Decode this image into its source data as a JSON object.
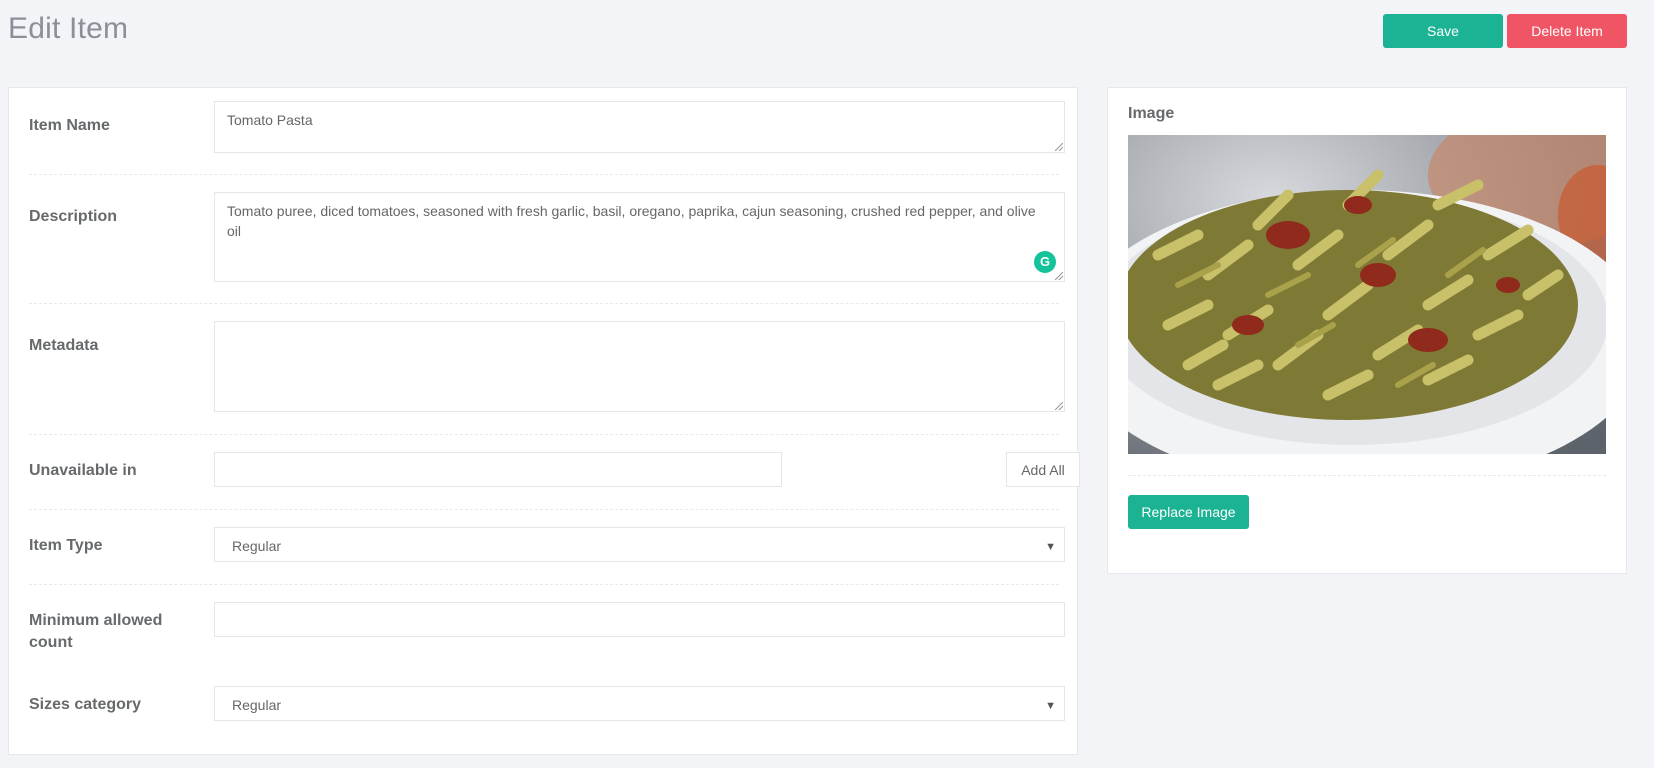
{
  "header": {
    "title": "Edit Item",
    "save_label": "Save",
    "delete_label": "Delete Item"
  },
  "form": {
    "item_name": {
      "label": "Item Name",
      "value": "Tomato Pasta"
    },
    "description": {
      "label": "Description",
      "value": "Tomato puree, diced tomatoes, seasoned with fresh garlic, basil, oregano, paprika, cajun seasoning, crushed red pepper, and olive oil"
    },
    "metadata": {
      "label": "Metadata",
      "value": ""
    },
    "unavailable_in": {
      "label": "Unavailable in",
      "value": "",
      "add_all_label": "Add All"
    },
    "item_type": {
      "label": "Item Type",
      "selected": "Regular"
    },
    "min_allowed_count": {
      "label": "Minimum allowed count",
      "value": ""
    },
    "sizes_category": {
      "label": "Sizes category",
      "selected": "Regular"
    }
  },
  "image_panel": {
    "title": "Image",
    "replace_label": "Replace Image"
  },
  "icons": {
    "grammarly": "grammarly-icon",
    "select_arrow": "chevron-down-icon",
    "resize": "resize-grip-icon"
  },
  "colors": {
    "primary": "#1bb394",
    "danger": "#ef5565",
    "background": "#f3f4f8"
  }
}
